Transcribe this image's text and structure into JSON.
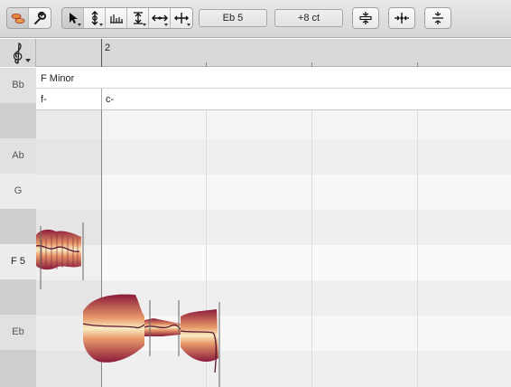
{
  "toolbar": {
    "pitch_field": "Eb 5",
    "cents_field": "+8 ct",
    "tools": [
      {
        "name": "blob-toggle-icon"
      },
      {
        "name": "wrench-icon"
      },
      {
        "name": "arrow-tool-icon"
      },
      {
        "name": "pitch-tool-icon"
      },
      {
        "name": "formant-tool-icon"
      },
      {
        "name": "amplitude-tool-icon"
      },
      {
        "name": "time-tool-icon"
      },
      {
        "name": "move-tool-icon"
      }
    ]
  },
  "ruler": {
    "bar": "2"
  },
  "key_lane": {
    "key": "F Minor"
  },
  "chords": [
    {
      "label": "f-"
    },
    {
      "label": "c-"
    }
  ],
  "pitch_rows": [
    {
      "label": "Bb",
      "shade": "light"
    },
    {
      "label": "",
      "shade": "dark"
    },
    {
      "label": "Ab",
      "shade": "light"
    },
    {
      "label": "G",
      "shade": "white"
    },
    {
      "label": "",
      "shade": "dark"
    },
    {
      "label": "F 5",
      "shade": "white"
    },
    {
      "label": "",
      "shade": "dark"
    },
    {
      "label": "Eb",
      "shade": "light"
    },
    {
      "label": "",
      "shade": "dark"
    }
  ],
  "colors": {
    "blob_fill_light": "#f6e5b0",
    "blob_fill_dark": "#8a1a3a",
    "blob_pitch_line": "#5a1530"
  }
}
